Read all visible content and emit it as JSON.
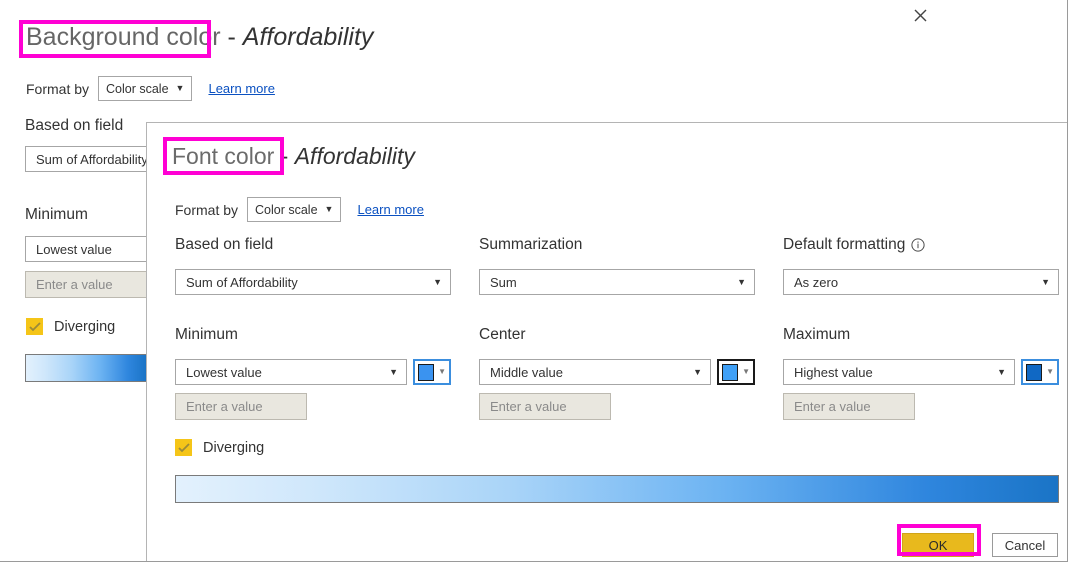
{
  "outer_dialog": {
    "title_main": "Background color",
    "title_separator": " - ",
    "title_field": "Affordability",
    "close_icon": "close-icon",
    "format_by_label": "Format by",
    "format_by_value": "Color scale",
    "learn_more": "Learn more",
    "based_on_field_label": "Based on field",
    "based_on_field_value": "Sum of Affordability",
    "minimum_label": "Minimum",
    "minimum_value": "Lowest value",
    "minimum_placeholder": "Enter a value",
    "diverging_label": "Diverging",
    "diverging_checked": true
  },
  "inner_dialog": {
    "title_main": "Font color",
    "title_separator": " - ",
    "title_field": "Affordability",
    "format_by_label": "Format by",
    "format_by_value": "Color scale",
    "learn_more": "Learn more",
    "based_on_field_label": "Based on field",
    "based_on_field_value": "Sum of Affordability",
    "summarization_label": "Summarization",
    "summarization_value": "Sum",
    "default_formatting_label": "Default formatting",
    "default_formatting_info_icon": "info-icon",
    "default_formatting_value": "As zero",
    "minimum_label": "Minimum",
    "minimum_value": "Lowest value",
    "minimum_placeholder": "Enter a value",
    "minimum_color": "#3a93f0",
    "center_label": "Center",
    "center_value": "Middle value",
    "center_placeholder": "Enter a value",
    "center_color": "#3fa0f7",
    "maximum_label": "Maximum",
    "maximum_value": "Highest value",
    "maximum_placeholder": "Enter a value",
    "maximum_color": "#1068c4",
    "diverging_label": "Diverging",
    "diverging_checked": true,
    "ok_label": "OK",
    "cancel_label": "Cancel"
  },
  "highlights": {
    "color": "#ff00d4",
    "targets": [
      "background-color-title",
      "font-color-title",
      "ok-button"
    ]
  },
  "gradient": {
    "start": "#e3f1fd",
    "end": "#1a74c6"
  }
}
